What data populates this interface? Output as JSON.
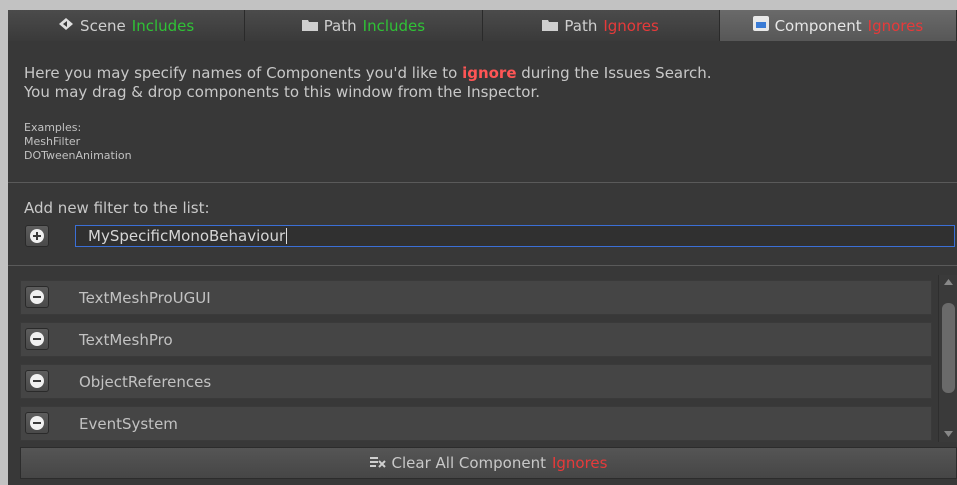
{
  "tabs": [
    {
      "icon": "scene-icon",
      "label": "Scene",
      "label_accent": "Includes",
      "accent": "green"
    },
    {
      "icon": "folder-icon",
      "label": "Path",
      "label_accent": "Includes",
      "accent": "green"
    },
    {
      "icon": "folder-icon",
      "label": "Path",
      "label_accent": "Ignores",
      "accent": "red"
    },
    {
      "icon": "component-icon",
      "label": "Component",
      "label_accent": "Ignores",
      "accent": "red",
      "active": true
    }
  ],
  "info": {
    "line1_a": "Here you may specify names of Components you'd like to ",
    "line1_emph": "ignore",
    "line1_b": " during the Issues Search.",
    "line2": "You may drag & drop components to this window from the Inspector."
  },
  "examples": {
    "title": "Examples:",
    "items": [
      "MeshFilter",
      "DOTweenAnimation"
    ]
  },
  "add": {
    "label": "Add new filter to the list:",
    "input_value": "MySpecificMonoBehaviour"
  },
  "list": [
    {
      "label": "TextMeshProUGUI"
    },
    {
      "label": "TextMeshPro"
    },
    {
      "label": "ObjectReferences"
    },
    {
      "label": "EventSystem"
    }
  ],
  "clear_button": {
    "label": "Clear All Component",
    "label_accent": "Ignores"
  },
  "colors": {
    "green": "#2fc236",
    "red": "#e63a3a",
    "focus": "#3b6fd6"
  }
}
